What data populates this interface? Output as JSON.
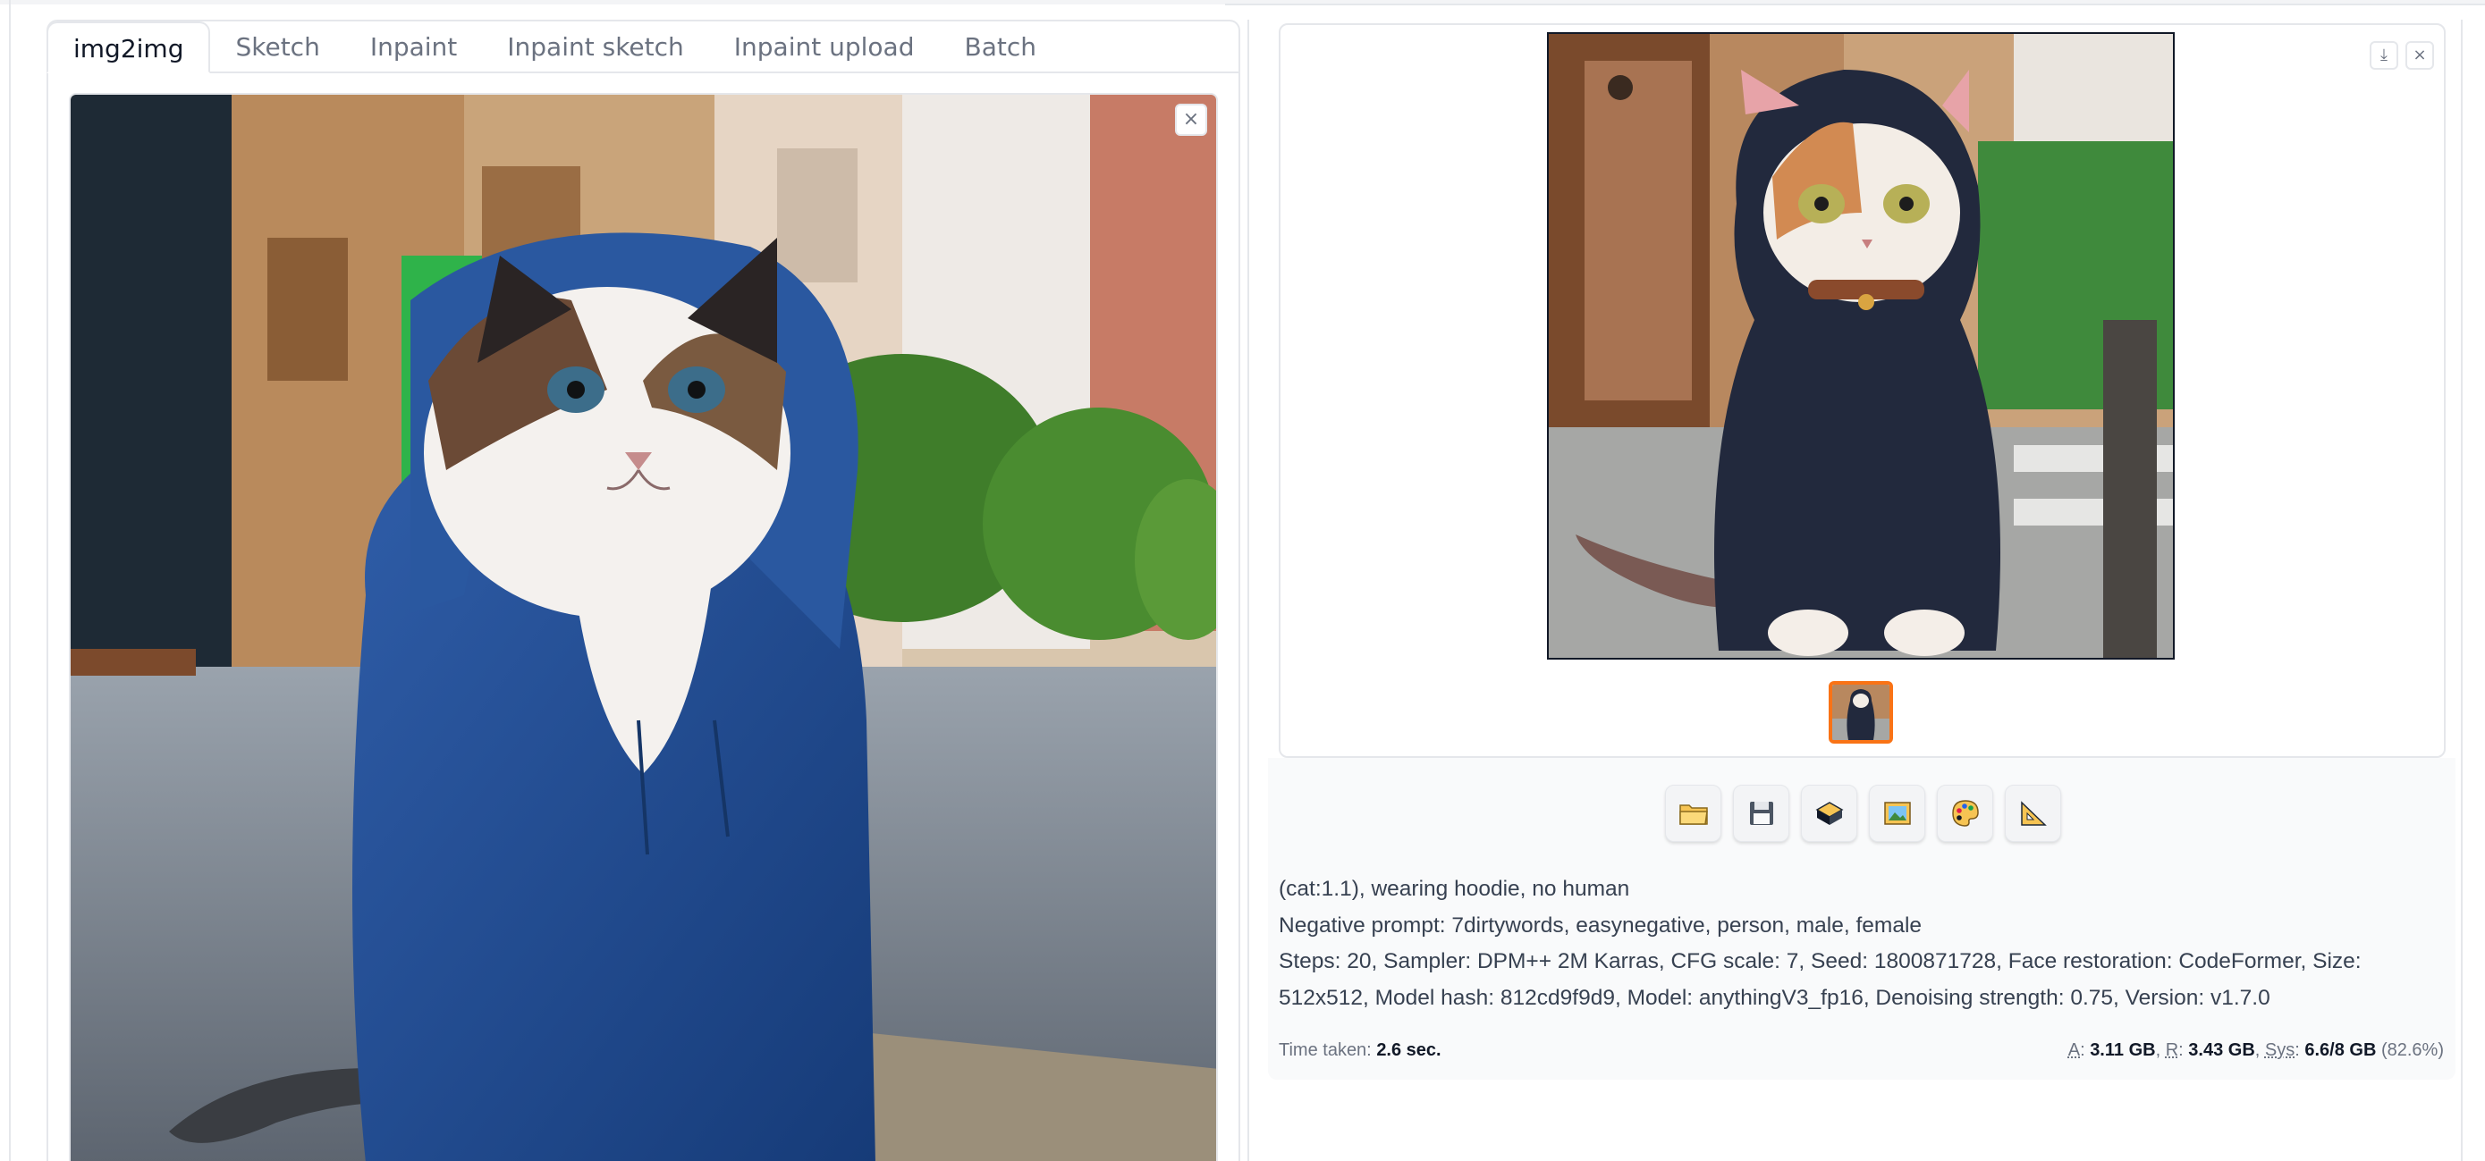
{
  "tabs": [
    {
      "label": "img2img",
      "active": true
    },
    {
      "label": "Sketch",
      "active": false
    },
    {
      "label": "Inpaint",
      "active": false
    },
    {
      "label": "Inpaint sketch",
      "active": false
    },
    {
      "label": "Inpaint upload",
      "active": false
    },
    {
      "label": "Batch",
      "active": false
    }
  ],
  "icons": {
    "close": "×",
    "download": "⤓"
  },
  "toolbar": {
    "buttons": [
      "open-folder",
      "save",
      "zip",
      "send-to-img2img",
      "send-to-inpaint",
      "send-to-extras"
    ]
  },
  "generation_info": {
    "prompt": "(cat:1.1), wearing hoodie, no human",
    "negative_prompt": "Negative prompt: 7dirtywords, easynegative, person, male, female",
    "params": "Steps: 20, Sampler: DPM++ 2M Karras, CFG scale: 7, Seed: 1800871728, Face restoration: CodeFormer, Size: 512x512, Model hash: 812cd9f9d9, Model: anythingV3_fp16, Denoising strength: 0.75, Version: v1.7.0"
  },
  "footer": {
    "time_label": "Time taken:",
    "time_value": "2.6 sec.",
    "a_label": "A",
    "a_value": "3.11 GB",
    "r_label": "R",
    "r_value": "3.43 GB",
    "sys_label": "Sys",
    "sys_value": "6.6/8 GB",
    "sys_percent": "(82.6%)"
  }
}
